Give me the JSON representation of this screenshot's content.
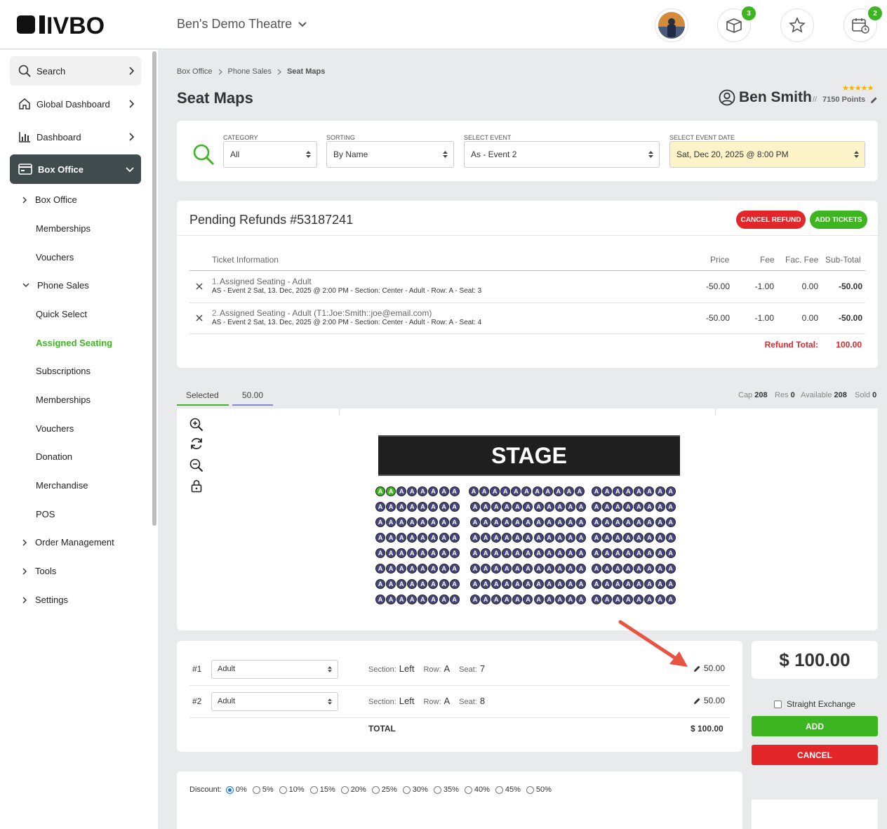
{
  "app": {
    "logo_text": "IVBO",
    "venue": "Ben's Demo Theatre"
  },
  "header": {
    "badges": {
      "tickets": "3",
      "calendar": "2"
    }
  },
  "sidebar": {
    "top_items": [
      {
        "label": "Search"
      },
      {
        "label": "Global Dashboard"
      },
      {
        "label": "Dashboard"
      },
      {
        "label": "Box Office"
      }
    ],
    "sub_items": {
      "box_office": "Box Office",
      "memberships": "Memberships",
      "vouchers": "Vouchers",
      "phone_sales": "Phone Sales",
      "quick_select": "Quick Select",
      "assigned_seating": "Assigned Seating",
      "subscriptions": "Subscriptions",
      "memberships2": "Memberships",
      "vouchers2": "Vouchers",
      "donation": "Donation",
      "merchandise": "Merchandise",
      "pos": "POS",
      "order_management": "Order Management",
      "tools": "Tools",
      "settings": "Settings"
    }
  },
  "breadcrumb": [
    "Box Office",
    "Phone Sales",
    "Seat Maps"
  ],
  "page_title": "Seat Maps",
  "user": {
    "name": "Ben Smith",
    "separator": "//",
    "points": "7150 Points",
    "stars": "★★★★★"
  },
  "filters": {
    "category": {
      "label": "CATEGORY",
      "value": "All"
    },
    "sorting": {
      "label": "SORTING",
      "value": "By Name"
    },
    "event": {
      "label": "SELECT EVENT",
      "value": "As - Event 2"
    },
    "date": {
      "label": "SELECT EVENT DATE",
      "value": "Sat, Dec 20, 2025 @ 8:00 PM"
    }
  },
  "refunds": {
    "title": "Pending Refunds #53187241",
    "cancel_label": "CANCEL REFUND",
    "add_label": "ADD TICKETS",
    "columns": [
      "Ticket Information",
      "Price",
      "Fee",
      "Fac. Fee",
      "Sub-Total"
    ],
    "rows": [
      {
        "index": "1.",
        "title": "Assigned Seating - Adult",
        "detail": "AS - Event 2 Sat, 13. Dec, 2025 @ 2:00 PM - Section: Center - Adult - Row: A - Seat: 3",
        "price": "-50.00",
        "fee": "-1.00",
        "fac_fee": "0.00",
        "subtotal": "-50.00"
      },
      {
        "index": "2.",
        "title": "Assigned Seating - Adult (T1:Joe:Smith::joe@email.com)",
        "detail": "AS - Event 2 Sat, 13. Dec, 2025 @ 2:00 PM - Section: Center - Adult - Row: A - Seat: 4",
        "price": "-50.00",
        "fee": "-1.00",
        "fac_fee": "0.00",
        "subtotal": "-50.00"
      }
    ],
    "total_label": "Refund Total:",
    "total_value": "100.00"
  },
  "tabs": {
    "selected": "Selected",
    "price": "50.00"
  },
  "stats": {
    "cap_label": "Cap",
    "cap": "208",
    "res_label": "Res",
    "res": "0",
    "avail_label": "Available",
    "avail": "208",
    "sold_label": "Sold",
    "sold": "0"
  },
  "seatmap": {
    "stage": "STAGE",
    "seat_letter": "A"
  },
  "selection": {
    "rows": [
      {
        "num": "#1",
        "type": "Adult",
        "section_label": "Section:",
        "section": "Left",
        "row_label": "Row:",
        "row": "A",
        "seat_label": "Seat:",
        "seat": "7",
        "price": "50.00"
      },
      {
        "num": "#2",
        "type": "Adult",
        "section_label": "Section:",
        "section": "Left",
        "row_label": "Row:",
        "row": "A",
        "seat_label": "Seat:",
        "seat": "8",
        "price": "50.00"
      }
    ],
    "total_label": "TOTAL",
    "total_value": "$ 100.00"
  },
  "summary": {
    "amount": "$ 100.00",
    "exchange_label": "Straight Exchange",
    "add_label": "ADD",
    "cancel_label": "CANCEL"
  },
  "discount": {
    "label": "Discount:",
    "options": [
      "0%",
      "5%",
      "10%",
      "15%",
      "20%",
      "25%",
      "30%",
      "35%",
      "40%",
      "45%",
      "50%"
    ],
    "selected": "0%"
  },
  "colors": {
    "green": "#3cb521",
    "red": "#e3262a",
    "seat": "#47457f",
    "date_bg": "#fdf3c8"
  }
}
